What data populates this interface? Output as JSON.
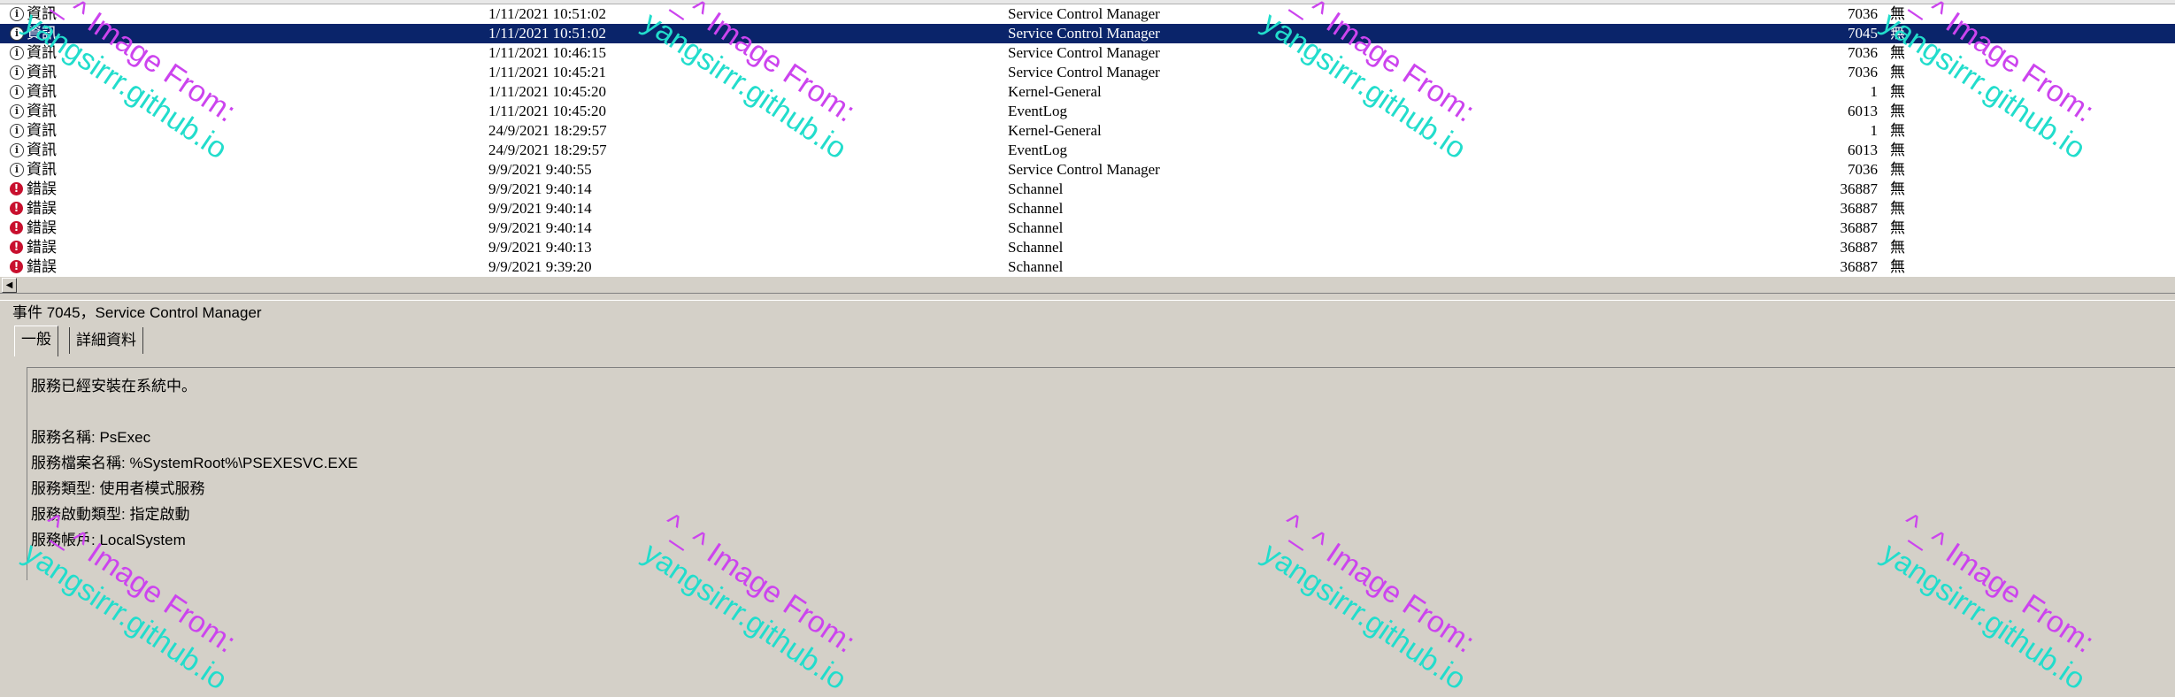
{
  "event_list": {
    "rows": [
      {
        "level_icon": "info-icon",
        "level": "資訊",
        "date": "1/11/2021 10:51:02",
        "source": "Service Control Manager",
        "event_id": "7036",
        "category": "無",
        "selected": false
      },
      {
        "level_icon": "info-icon",
        "level": "資訊",
        "date": "1/11/2021 10:51:02",
        "source": "Service Control Manager",
        "event_id": "7045",
        "category": "無",
        "selected": true
      },
      {
        "level_icon": "info-icon",
        "level": "資訊",
        "date": "1/11/2021 10:46:15",
        "source": "Service Control Manager",
        "event_id": "7036",
        "category": "無",
        "selected": false
      },
      {
        "level_icon": "info-icon",
        "level": "資訊",
        "date": "1/11/2021 10:45:21",
        "source": "Service Control Manager",
        "event_id": "7036",
        "category": "無",
        "selected": false
      },
      {
        "level_icon": "info-icon",
        "level": "資訊",
        "date": "1/11/2021 10:45:20",
        "source": "Kernel-General",
        "event_id": "1",
        "category": "無",
        "selected": false
      },
      {
        "level_icon": "info-icon",
        "level": "資訊",
        "date": "1/11/2021 10:45:20",
        "source": "EventLog",
        "event_id": "6013",
        "category": "無",
        "selected": false
      },
      {
        "level_icon": "info-icon",
        "level": "資訊",
        "date": "24/9/2021 18:29:57",
        "source": "Kernel-General",
        "event_id": "1",
        "category": "無",
        "selected": false
      },
      {
        "level_icon": "info-icon",
        "level": "資訊",
        "date": "24/9/2021 18:29:57",
        "source": "EventLog",
        "event_id": "6013",
        "category": "無",
        "selected": false
      },
      {
        "level_icon": "info-icon",
        "level": "資訊",
        "date": "9/9/2021 9:40:55",
        "source": "Service Control Manager",
        "event_id": "7036",
        "category": "無",
        "selected": false
      },
      {
        "level_icon": "error-icon",
        "level": "錯誤",
        "date": "9/9/2021 9:40:14",
        "source": "Schannel",
        "event_id": "36887",
        "category": "無",
        "selected": false
      },
      {
        "level_icon": "error-icon",
        "level": "錯誤",
        "date": "9/9/2021 9:40:14",
        "source": "Schannel",
        "event_id": "36887",
        "category": "無",
        "selected": false
      },
      {
        "level_icon": "error-icon",
        "level": "錯誤",
        "date": "9/9/2021 9:40:14",
        "source": "Schannel",
        "event_id": "36887",
        "category": "無",
        "selected": false
      },
      {
        "level_icon": "error-icon",
        "level": "錯誤",
        "date": "9/9/2021 9:40:13",
        "source": "Schannel",
        "event_id": "36887",
        "category": "無",
        "selected": false
      },
      {
        "level_icon": "error-icon",
        "level": "錯誤",
        "date": "9/9/2021 9:39:20",
        "source": "Schannel",
        "event_id": "36887",
        "category": "無",
        "selected": false
      }
    ]
  },
  "details": {
    "title": "事件 7045，Service Control Manager",
    "tabs": [
      {
        "label": "一般",
        "active": true
      },
      {
        "label": "詳細資料",
        "active": false
      }
    ],
    "description": [
      "服務已經安裝在系統中。",
      "",
      "服務名稱:  PsExec",
      "服務檔案名稱:  %SystemRoot%\\PSEXESVC.EXE",
      "服務類型:  使用者模式服務",
      "服務啟動類型:  指定啟動",
      "服務帳戶:  LocalSystem"
    ]
  },
  "watermark": {
    "line1": "^_^ Image From:",
    "line2": "yangsirrr.github.io"
  },
  "colors": {
    "selection": "#0a246a",
    "error": "#c8102e",
    "watermark_purple": "#cc44ee",
    "watermark_cyan": "#22ddcc",
    "chrome": "#d4d0c8"
  }
}
